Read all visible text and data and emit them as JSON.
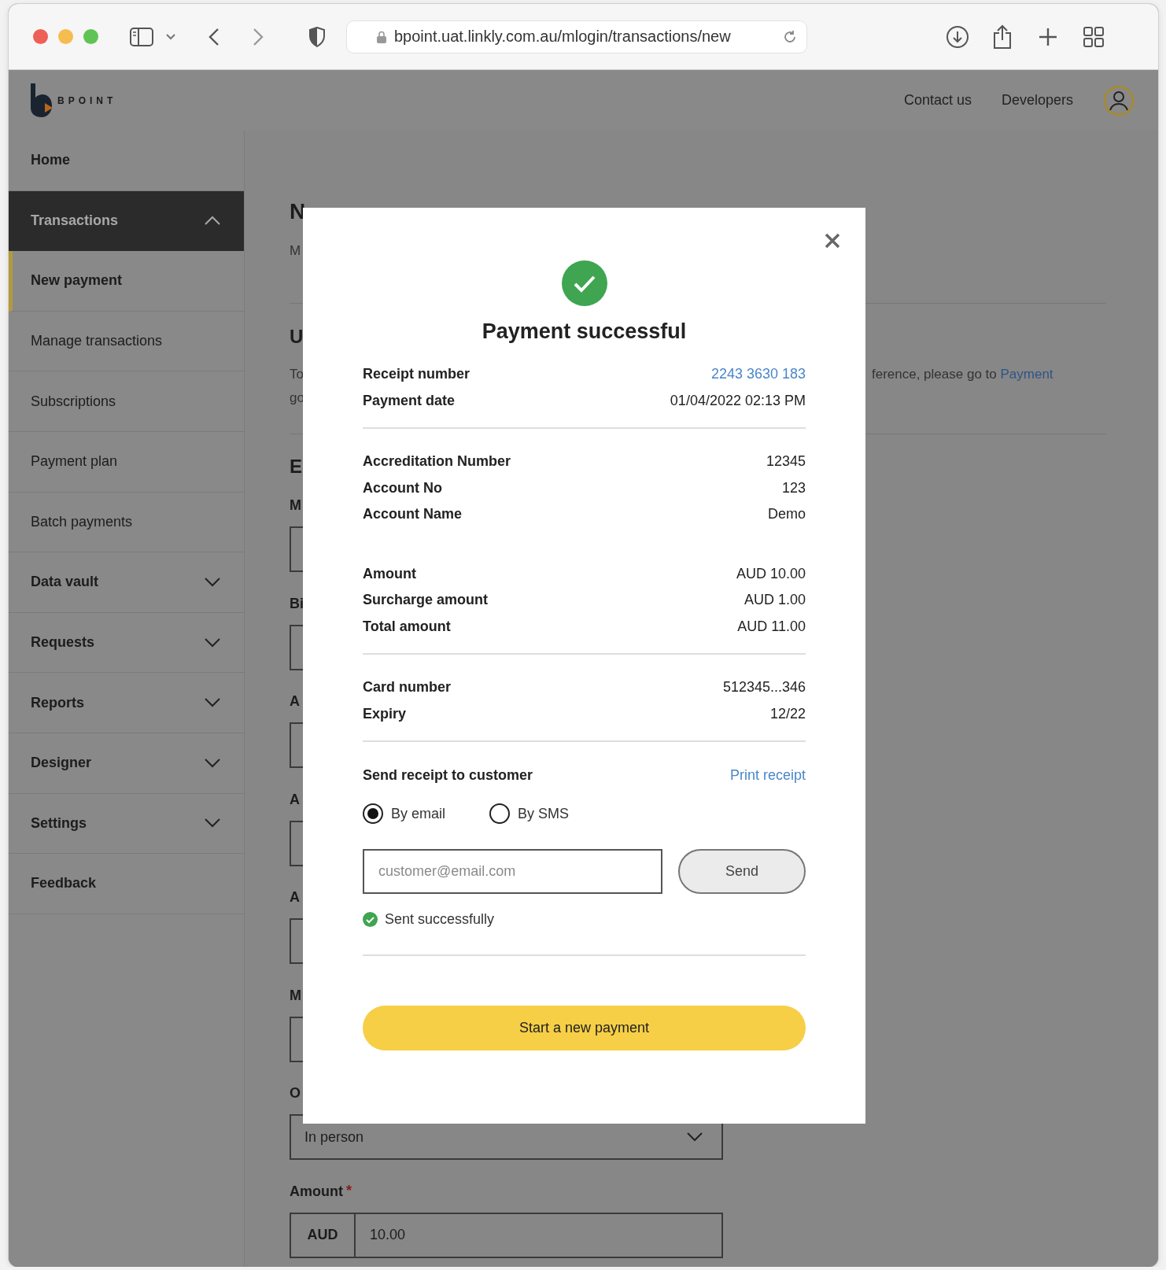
{
  "browser": {
    "url": "bpoint.uat.linkly.com.au/mlogin/transactions/new"
  },
  "header": {
    "logo_text": "BPOINT",
    "nav_links": [
      "Contact us",
      "Developers"
    ]
  },
  "sidebar": {
    "items": [
      {
        "label": "Home",
        "kind": "link",
        "selected": false
      },
      {
        "label": "Transactions",
        "kind": "group",
        "expanded": true,
        "selected": false,
        "children": [
          {
            "label": "New payment",
            "kind": "link",
            "selected": true
          },
          {
            "label": "Manage transactions",
            "kind": "link",
            "selected": false
          },
          {
            "label": "Subscriptions",
            "kind": "link",
            "selected": false
          },
          {
            "label": "Payment plan",
            "kind": "link",
            "selected": false
          },
          {
            "label": "Batch payments",
            "kind": "link",
            "selected": false
          }
        ]
      },
      {
        "label": "Data vault",
        "kind": "group",
        "expanded": false,
        "selected": false
      },
      {
        "label": "Requests",
        "kind": "group",
        "expanded": false,
        "selected": false
      },
      {
        "label": "Reports",
        "kind": "group",
        "expanded": false,
        "selected": false
      },
      {
        "label": "Designer",
        "kind": "group",
        "expanded": false,
        "selected": false
      },
      {
        "label": "Settings",
        "kind": "group",
        "expanded": false,
        "selected": false
      },
      {
        "label": "Feedback",
        "kind": "link",
        "selected": false
      }
    ]
  },
  "page": {
    "title": "N",
    "subtitle": "M",
    "section_heading": "U",
    "paragraph_lines": [
      "To",
      "go"
    ],
    "paragraph_tail": "ference, please go to",
    "paragraph_link": "Payment",
    "form_heading": "E",
    "fields": [
      {
        "label": "M",
        "kind": "text"
      },
      {
        "label": "Bi",
        "kind": "text"
      },
      {
        "label": "A",
        "kind": "text"
      },
      {
        "label": "A",
        "kind": "text"
      },
      {
        "label": "A",
        "kind": "text"
      },
      {
        "label": "M",
        "kind": "text"
      },
      {
        "label": "O",
        "kind": "select",
        "value": "In person"
      },
      {
        "label": "Amount",
        "required_mark": "*",
        "kind": "amount",
        "currency": "AUD",
        "value": "10.00"
      }
    ]
  },
  "modal": {
    "title": "Payment successful",
    "groups": [
      {
        "divider_after": true,
        "rows": [
          {
            "label": "Receipt number",
            "value": "2243 3630 183",
            "link": true
          },
          {
            "label": "Payment date",
            "value": "01/04/2022 02:13 PM",
            "link": false
          }
        ]
      },
      {
        "divider_after": false,
        "rows": [
          {
            "label": "Accreditation Number",
            "value": "12345",
            "link": false
          },
          {
            "label": "Account No",
            "value": "123",
            "link": false
          },
          {
            "label": "Account Name",
            "value": "Demo",
            "link": false
          }
        ]
      },
      {
        "divider_after": true,
        "rows": [
          {
            "label": "Amount",
            "value": "AUD 10.00",
            "link": false
          },
          {
            "label": "Surcharge amount",
            "value": "AUD 1.00",
            "link": false
          },
          {
            "label": "Total amount",
            "value": "AUD 11.00",
            "link": false
          }
        ]
      },
      {
        "divider_after": true,
        "rows": [
          {
            "label": "Card number",
            "value": "512345...346",
            "link": false
          },
          {
            "label": "Expiry",
            "value": "12/22",
            "link": false
          }
        ]
      }
    ],
    "send_receipt": {
      "heading": "Send receipt to customer",
      "print_link": "Print receipt",
      "options": [
        {
          "label": "By email",
          "selected": true
        },
        {
          "label": "By SMS",
          "selected": false
        }
      ],
      "email_placeholder": "customer@email.com",
      "send_button": "Send",
      "status": "Sent successfully"
    },
    "primary_button": "Start a new payment"
  }
}
